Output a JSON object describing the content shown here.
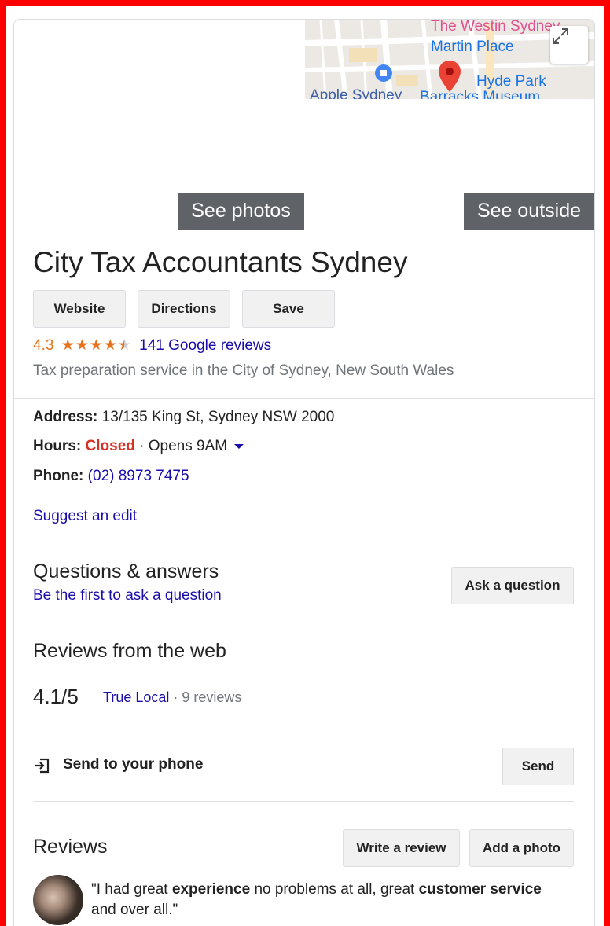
{
  "map": {
    "labels": {
      "westin": "The Westin Sydney",
      "martin_place": "Martin Place",
      "hyde_park": "Hyde Park",
      "apple": "Apple Sydney",
      "barracks": "Barracks Museum"
    },
    "expand_icon": "expand-icon",
    "pin_color": "#ea4335"
  },
  "photos": {
    "see_photos": "See photos",
    "see_outside": "See outside"
  },
  "business": {
    "name": "City Tax Accountants Sydney",
    "rating": "4.3",
    "stars_filled": 4.3,
    "stars_max": 5,
    "reviews_link": "141 Google reviews",
    "category": "Tax preparation service in the City of Sydney, New South Wales"
  },
  "actions": {
    "website": "Website",
    "directions": "Directions",
    "save": "Save"
  },
  "info": {
    "address_label": "Address:",
    "address": "13/135 King St, Sydney NSW 2000",
    "hours_label": "Hours:",
    "hours_status": "Closed",
    "hours_next": "· Opens 9AM",
    "phone_label": "Phone:",
    "phone": "(02) 8973 7475",
    "suggest_edit": "Suggest an edit"
  },
  "qa": {
    "title": "Questions & answers",
    "subtitle": "Be the first to ask a question",
    "ask_button": "Ask a question"
  },
  "web_reviews": {
    "title": "Reviews from the web",
    "score": "4.1/5",
    "source": "True Local",
    "count": "· 9 reviews"
  },
  "send": {
    "label": "Send to your phone",
    "button": "Send"
  },
  "reviews": {
    "title": "Reviews",
    "write_button": "Write a review",
    "add_photo_button": "Add a photo",
    "snippet": {
      "open_quote": "\"I had great ",
      "bold1": "experience",
      "mid1": " no problems at all, great ",
      "bold2": "customer service",
      "end": " and over all.\""
    }
  },
  "colors": {
    "frame": "#ff0000",
    "rating": "#e7711b",
    "link": "#1a0dab",
    "closed": "#d93025",
    "photo_button_bg": "#5f6368"
  }
}
